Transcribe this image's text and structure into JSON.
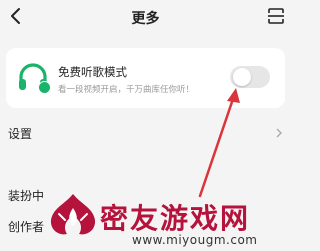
{
  "header": {
    "title": "更多"
  },
  "free_music_card": {
    "title": "免费听歌模式",
    "subtitle": "看一段视频开启，千万曲库任你听！",
    "toggle_on": false
  },
  "menu": [
    {
      "label": "设置",
      "has_chevron": true
    },
    {
      "label": "装扮中"
    },
    {
      "label": "创作者"
    }
  ],
  "watermark": {
    "brand": "密友游戏网",
    "url": "www.miyougm.com"
  },
  "colors": {
    "accent_green": "#1bb36a",
    "arrow_red": "#d9353b",
    "watermark_red": "#b5133b"
  }
}
